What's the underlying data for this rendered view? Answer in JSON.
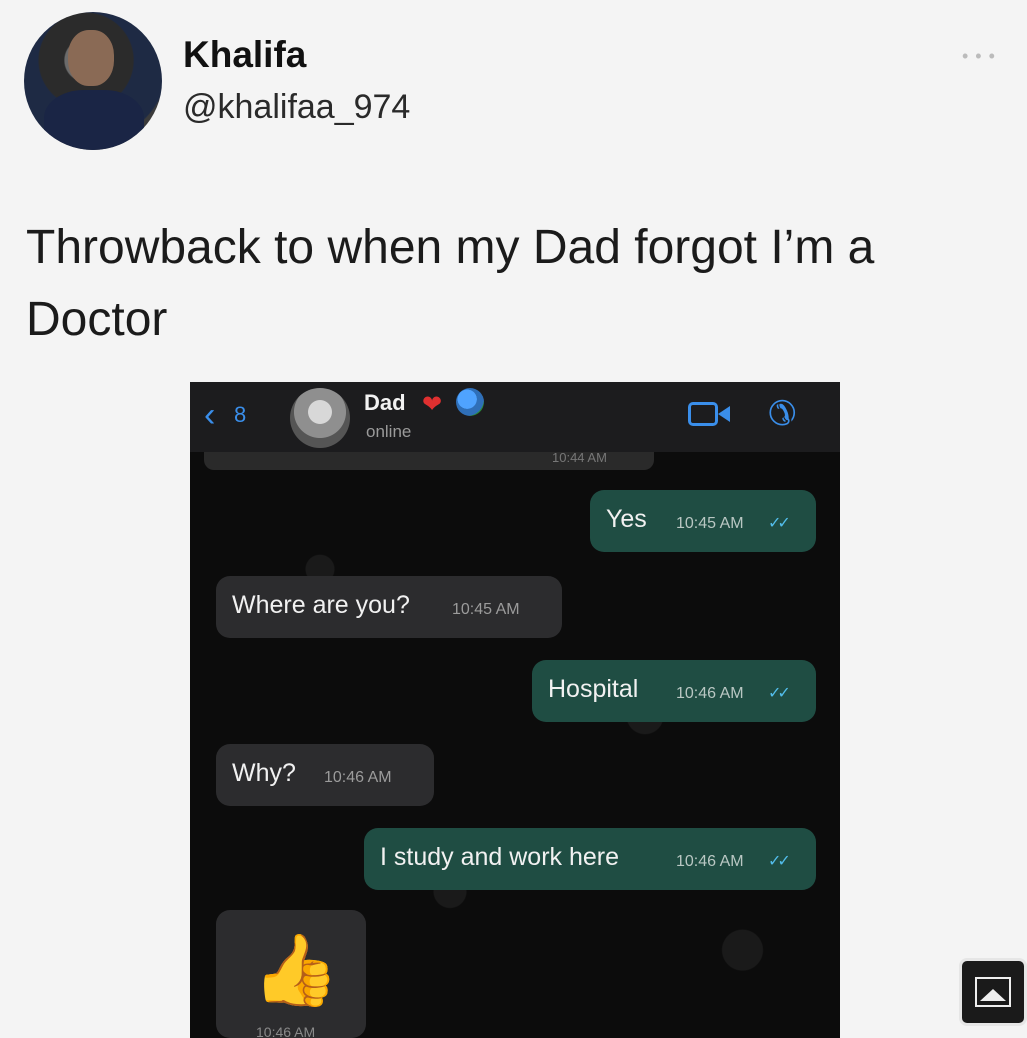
{
  "tweet": {
    "display_name": "Khalifa",
    "handle": "@khalifaa_974",
    "text": "Throwback to when my Dad forgot I’m a Doctor"
  },
  "chat": {
    "back_count": "8",
    "contact_name": "Dad",
    "status": "online",
    "top_time": "10:44 AM",
    "messages": [
      {
        "direction": "out",
        "text": "Yes",
        "time": "10:45 AM"
      },
      {
        "direction": "in",
        "text": "Where are you?",
        "time": "10:45 AM"
      },
      {
        "direction": "out",
        "text": "Hospital",
        "time": "10:46 AM"
      },
      {
        "direction": "in",
        "text": "Why?",
        "time": "10:46 AM"
      },
      {
        "direction": "out",
        "text": "I study and work here",
        "time": "10:46 AM"
      }
    ],
    "last_emoji": "👍",
    "last_time": "10:46 AM"
  },
  "colors": {
    "outgoing_bubble": "#1f4d43",
    "incoming_bubble": "#2c2c2e",
    "accent_blue": "#3a8eea",
    "read_ticks": "#53bdeb"
  },
  "icons": [
    "more-icon",
    "back-chevron-icon",
    "heart-icon",
    "globe-icon",
    "video-call-icon",
    "phone-call-icon",
    "thumbs-up-icon",
    "image-icon"
  ]
}
